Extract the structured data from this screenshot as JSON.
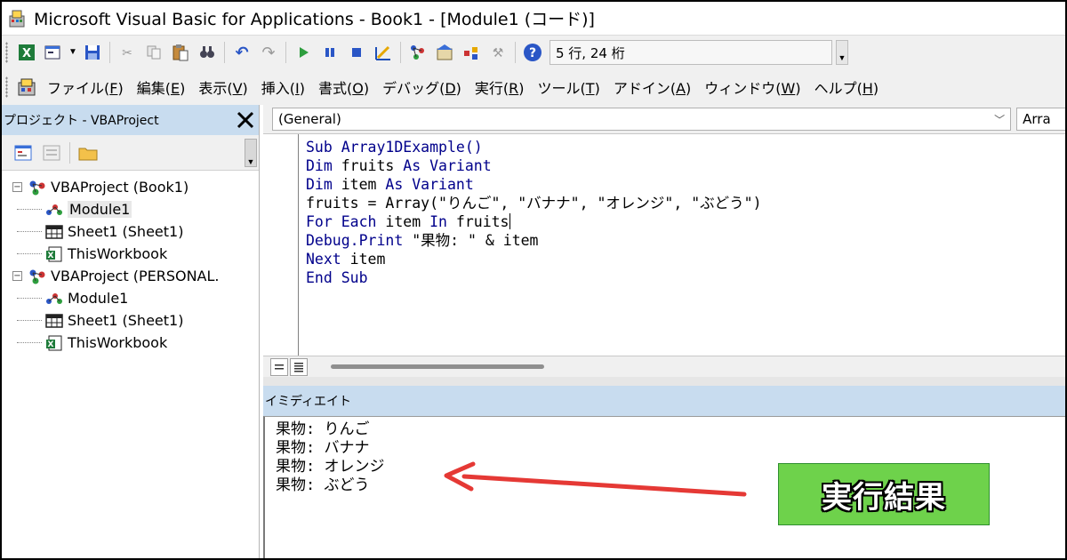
{
  "window": {
    "title": "Microsoft Visual Basic for Applications - Book1 - [Module1 (コード)]"
  },
  "toolbar": {
    "position_text": "5 行, 24 桁",
    "icons": [
      "excel-icon",
      "insert-form-icon",
      "save-icon",
      "cut-icon",
      "copy-icon",
      "paste-icon",
      "find-icon",
      "undo-icon",
      "redo-icon",
      "run-icon",
      "break-icon",
      "reset-icon",
      "design-mode-icon",
      "project-explorer-icon",
      "properties-icon",
      "object-browser-icon",
      "toolbox-icon",
      "help-icon"
    ]
  },
  "menu": {
    "items": [
      {
        "label": "ファイル(",
        "key": "F",
        "tail": ")"
      },
      {
        "label": "編集(",
        "key": "E",
        "tail": ")"
      },
      {
        "label": "表示(",
        "key": "V",
        "tail": ")"
      },
      {
        "label": "挿入(",
        "key": "I",
        "tail": ")"
      },
      {
        "label": "書式(",
        "key": "O",
        "tail": ")"
      },
      {
        "label": "デバッグ(",
        "key": "D",
        "tail": ")"
      },
      {
        "label": "実行(",
        "key": "R",
        "tail": ")"
      },
      {
        "label": "ツール(",
        "key": "T",
        "tail": ")"
      },
      {
        "label": "アドイン(",
        "key": "A",
        "tail": ")"
      },
      {
        "label": "ウィンドウ(",
        "key": "W",
        "tail": ")"
      },
      {
        "label": "ヘルプ(",
        "key": "H",
        "tail": ")"
      }
    ]
  },
  "project": {
    "title": "プロジェクト - VBAProject",
    "close": "✕",
    "tree": [
      {
        "kind": "project",
        "label": "VBAProject (Book1)"
      },
      {
        "kind": "module",
        "label": "Module1",
        "selected": true
      },
      {
        "kind": "sheet",
        "label": "Sheet1 (Sheet1)"
      },
      {
        "kind": "workbook",
        "label": "ThisWorkbook"
      },
      {
        "kind": "project",
        "label": "VBAProject (PERSONAL."
      },
      {
        "kind": "module",
        "label": "Module1"
      },
      {
        "kind": "sheet",
        "label": "Sheet1 (Sheet1)"
      },
      {
        "kind": "workbook",
        "label": "ThisWorkbook"
      }
    ]
  },
  "code_window": {
    "object_combo": "(General)",
    "proc_combo": "Arra",
    "lines": [
      [
        {
          "t": "Sub ",
          "k": true
        },
        {
          "t": "Array1DExample()",
          "k": true
        }
      ],
      [
        {
          "t": "Dim ",
          "k": true
        },
        {
          "t": "fruits ",
          "k": false
        },
        {
          "t": "As Variant",
          "k": true
        }
      ],
      [
        {
          "t": "Dim ",
          "k": true
        },
        {
          "t": "item ",
          "k": false
        },
        {
          "t": "As Variant",
          "k": true
        }
      ],
      [
        {
          "t": "fruits = Array(\"りんご\", \"バナナ\", \"オレンジ\", \"ぶどう\")",
          "k": false
        }
      ],
      [
        {
          "t": "For Each ",
          "k": true
        },
        {
          "t": "item ",
          "k": false
        },
        {
          "t": "In ",
          "k": true
        },
        {
          "t": "fruits",
          "k": false
        },
        {
          "caret": true
        }
      ],
      [
        {
          "t": "Debug.Print ",
          "k": true
        },
        {
          "t": "\"果物: \" & item",
          "k": false
        }
      ],
      [
        {
          "t": "Next ",
          "k": true
        },
        {
          "t": "item",
          "k": false
        }
      ],
      [
        {
          "t": "End Sub",
          "k": true
        }
      ]
    ]
  },
  "immediate": {
    "title": "イミディエイト",
    "lines": [
      "果物: りんご",
      "果物: バナナ",
      "果物: オレンジ",
      "果物: ぶどう"
    ]
  },
  "annotation": {
    "label": "実行結果",
    "arrow_color": "#e53935",
    "badge_color": "#6ed24b"
  }
}
